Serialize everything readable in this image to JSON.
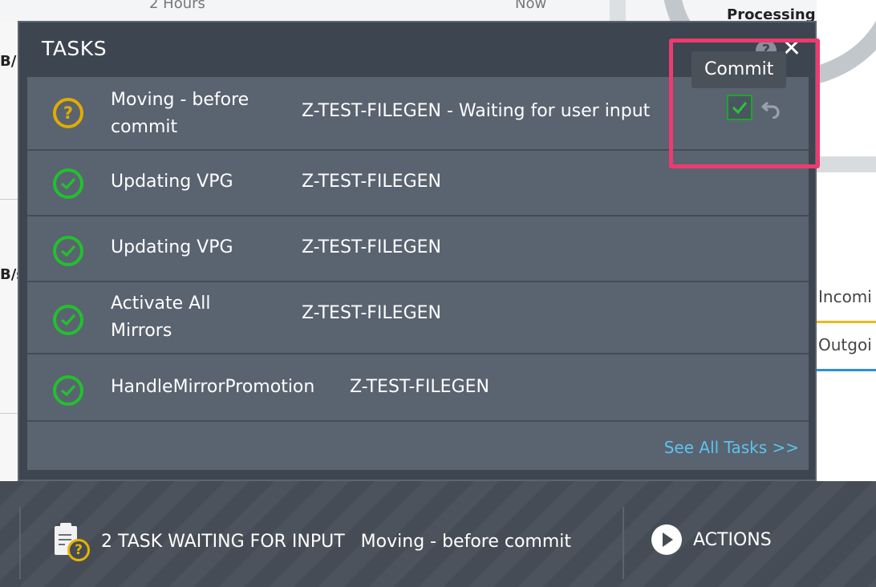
{
  "background": {
    "top_left_text": "2 Hours",
    "top_mid_text": "Now",
    "processing_label": "Processing",
    "left_fragment_1": "B/",
    "left_fragment_2": "B/s",
    "legend_incoming": "Incomi",
    "legend_outgoing": "Outgoi",
    "incoming_color": "#f2b61c",
    "outgoing_color": "#2f8fd6"
  },
  "panel": {
    "title": "TASKS",
    "help_icon": "?",
    "close_icon": "✕",
    "see_all_label": "See All Tasks >>"
  },
  "tasks": [
    {
      "status": "waiting",
      "status_icon": "question-icon",
      "name": "Moving - before commit",
      "detail": "Z-TEST-FILEGEN - Waiting for user input"
    },
    {
      "status": "done",
      "status_icon": "check-circle-icon",
      "name": "Updating VPG",
      "detail": "Z-TEST-FILEGEN"
    },
    {
      "status": "done",
      "status_icon": "check-circle-icon",
      "name": "Updating VPG",
      "detail": "Z-TEST-FILEGEN"
    },
    {
      "status": "done",
      "status_icon": "check-circle-icon",
      "name": "Activate All Mirrors",
      "detail": "Z-TEST-FILEGEN"
    },
    {
      "status": "done",
      "status_icon": "check-circle-icon",
      "name": "HandleMirrorPromotion",
      "detail": "Z-TEST-FILEGEN"
    }
  ],
  "tooltip": {
    "text": "Commit"
  },
  "bottom_bar": {
    "tasks_waiting_label": "2 TASK WAITING FOR INPUT",
    "current_task": "Moving - before commit",
    "actions_label": "ACTIONS"
  },
  "colors": {
    "panel_bg": "#3d4550",
    "row_bg": "#5a6370",
    "success": "#22c02e",
    "warning": "#e0ac00",
    "link": "#5ec3ef",
    "highlight": "#ee3a6f"
  }
}
